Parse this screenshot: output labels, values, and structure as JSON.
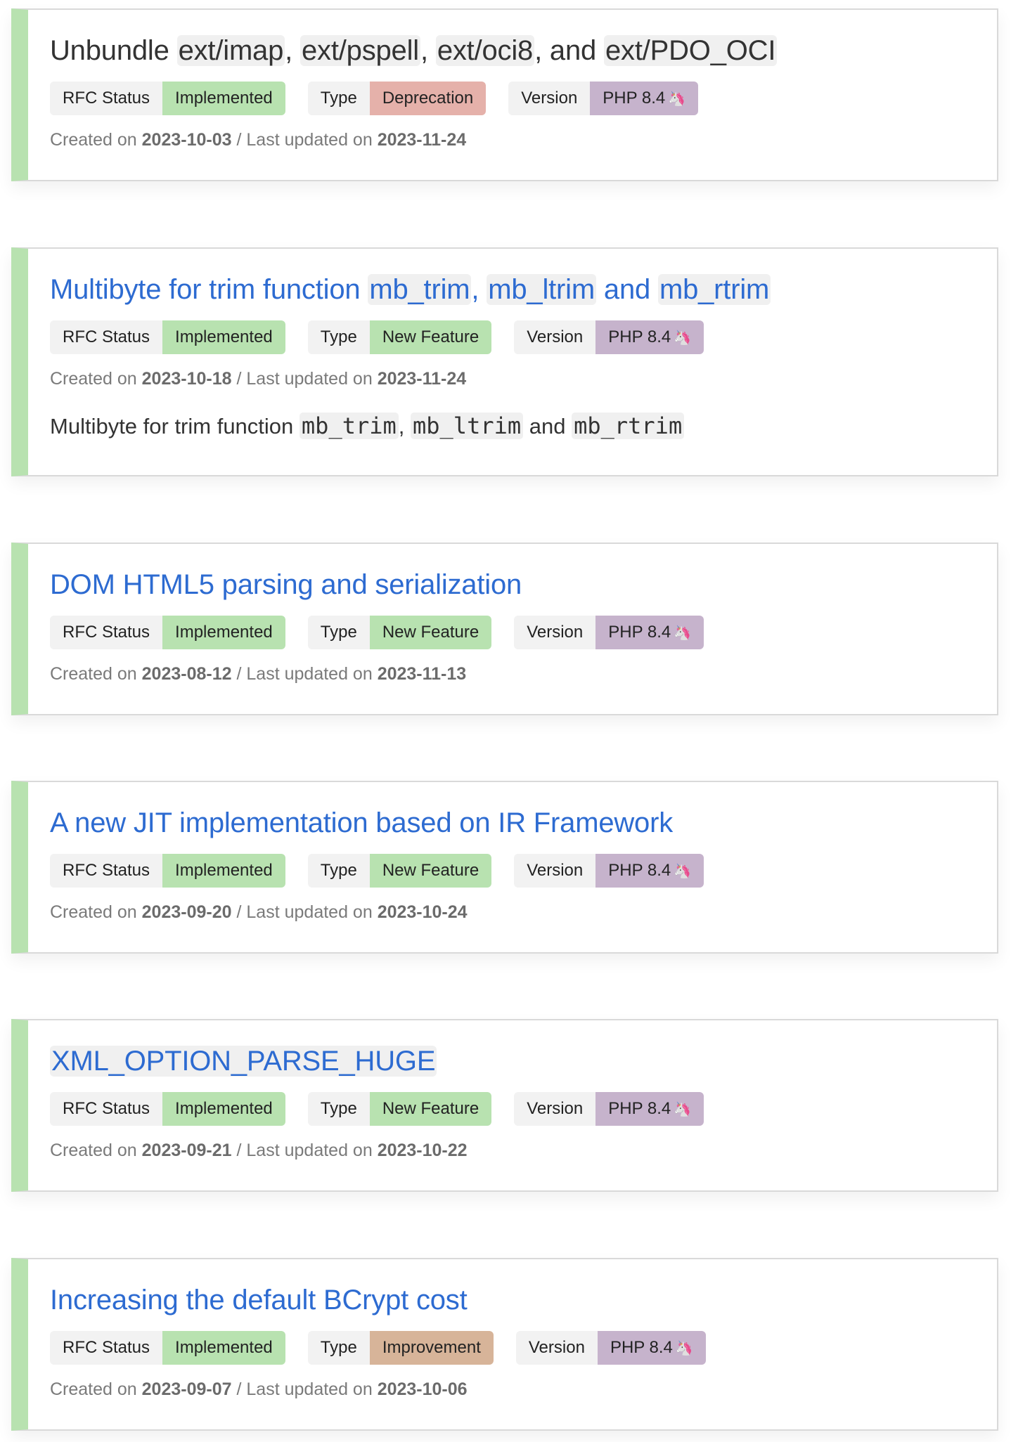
{
  "labels": {
    "rfc_status": "RFC Status",
    "type": "Type",
    "version": "Version",
    "created_on": "Created on",
    "separator": "/",
    "last_updated_on": "Last updated on"
  },
  "colors": {
    "accent_bar": "#b8e2b0",
    "link": "#2d6bd1",
    "implemented": "#b8e2b0",
    "new_feature": "#b8e2b0",
    "deprecation": "#e5b1aa",
    "improvement": "#d7b499",
    "version": "#c6b3cc"
  },
  "rfcs": [
    {
      "title_parts": [
        "Unbundle ",
        "ext/imap",
        ", ",
        "ext/pspell",
        ", ",
        "ext/oci8",
        ", and ",
        "ext/PDO_OCI"
      ],
      "status": "Implemented",
      "type": "Deprecation",
      "version": "PHP 8.4",
      "version_icon": "🦄",
      "created": "2023-10-03",
      "updated": "2023-11-24"
    },
    {
      "title_parts": [
        "Multibyte for trim function ",
        "mb_trim",
        ", ",
        "mb_ltrim",
        " and ",
        "mb_rtrim"
      ],
      "status": "Implemented",
      "type": "New Feature",
      "version": "PHP 8.4",
      "version_icon": "🦄",
      "created": "2023-10-18",
      "updated": "2023-11-24",
      "desc_parts": [
        "Multibyte for trim function ",
        "mb_trim",
        ", ",
        "mb_ltrim",
        " and ",
        "mb_rtrim"
      ]
    },
    {
      "title": "DOM HTML5 parsing and serialization",
      "status": "Implemented",
      "type": "New Feature",
      "version": "PHP 8.4",
      "version_icon": "🦄",
      "created": "2023-08-12",
      "updated": "2023-11-13"
    },
    {
      "title": "A new JIT implementation based on IR Framework",
      "status": "Implemented",
      "type": "New Feature",
      "version": "PHP 8.4",
      "version_icon": "🦄",
      "created": "2023-09-20",
      "updated": "2023-10-24"
    },
    {
      "title": "XML_OPTION_PARSE_HUGE",
      "status": "Implemented",
      "type": "New Feature",
      "version": "PHP 8.4",
      "version_icon": "🦄",
      "created": "2023-09-21",
      "updated": "2023-10-22"
    },
    {
      "title": "Increasing the default BCrypt cost",
      "status": "Implemented",
      "type": "Improvement",
      "version": "PHP 8.4",
      "version_icon": "🦄",
      "created": "2023-09-07",
      "updated": "2023-10-06"
    }
  ]
}
